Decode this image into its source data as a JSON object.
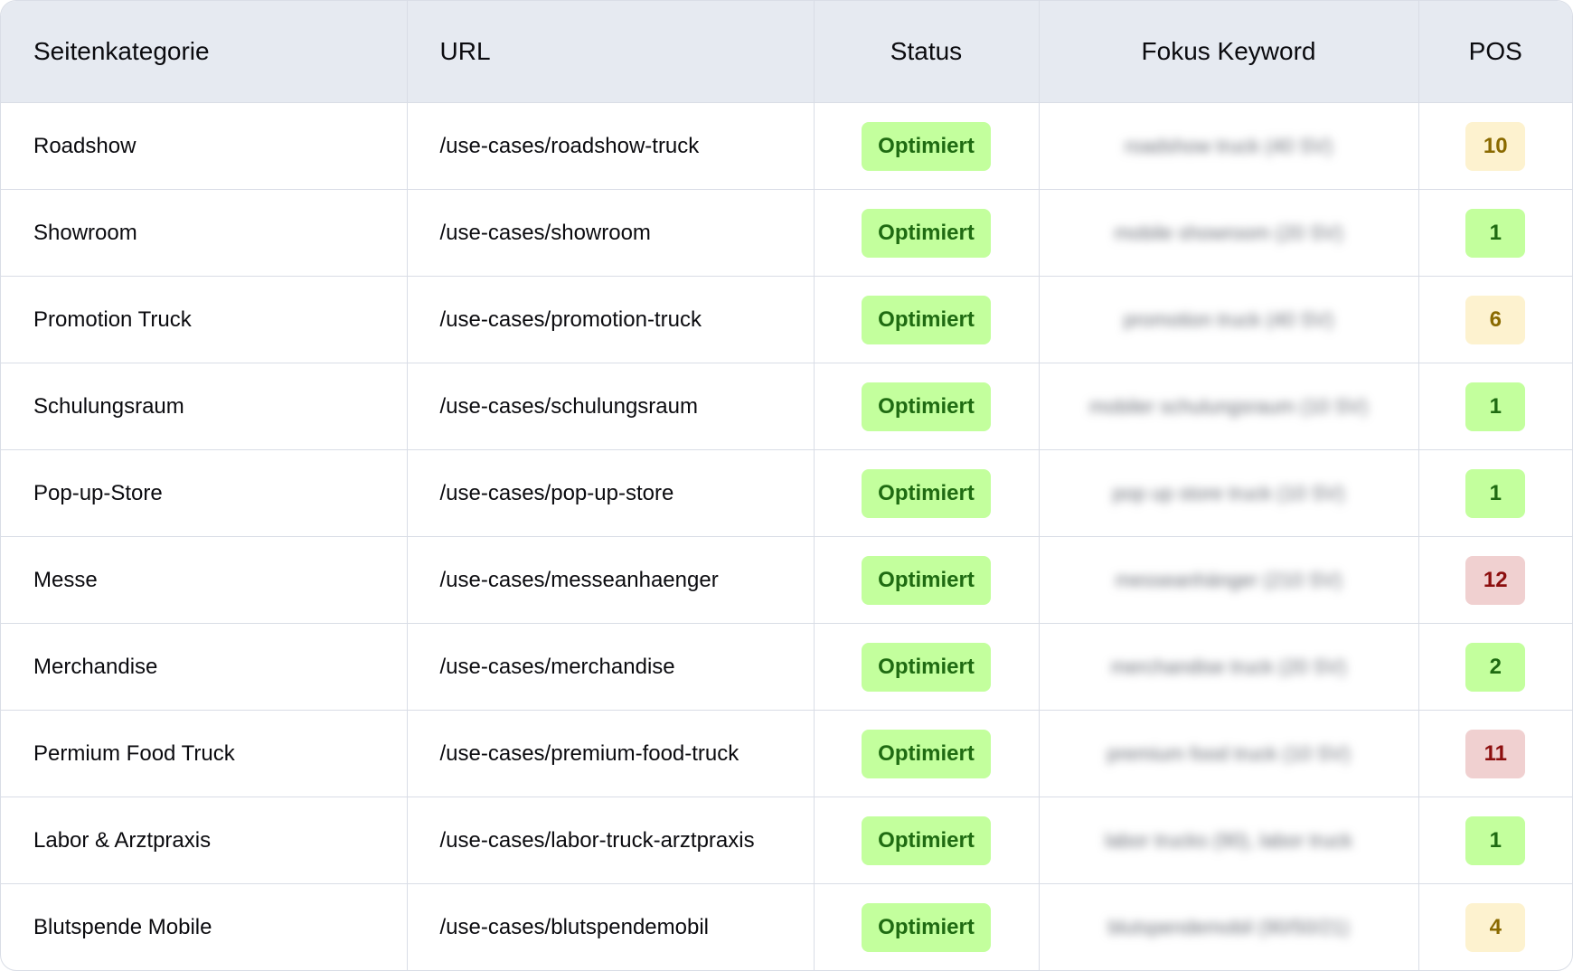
{
  "table": {
    "headers": {
      "category": "Seitenkategorie",
      "url": "URL",
      "status": "Status",
      "keyword": "Fokus Keyword",
      "pos": "POS"
    },
    "rows": [
      {
        "category": "Roadshow",
        "url": "/use-cases/roadshow-truck",
        "status": "Optimiert",
        "keyword": "roadshow truck (40 SV)",
        "pos": "10",
        "pos_level": "mid"
      },
      {
        "category": "Showroom",
        "url": "/use-cases/showroom",
        "status": "Optimiert",
        "keyword": "mobile showroom (20 SV)",
        "pos": "1",
        "pos_level": "good"
      },
      {
        "category": "Promotion Truck",
        "url": "/use-cases/promotion-truck",
        "status": "Optimiert",
        "keyword": "promotion truck (40 SV)",
        "pos": "6",
        "pos_level": "mid"
      },
      {
        "category": "Schulungsraum",
        "url": "/use-cases/schulungsraum",
        "status": "Optimiert",
        "keyword": "mobiler schulungsraum (10 SV)",
        "pos": "1",
        "pos_level": "good"
      },
      {
        "category": "Pop-up-Store",
        "url": "/use-cases/pop-up-store",
        "status": "Optimiert",
        "keyword": "pop up store truck (10 SV)",
        "pos": "1",
        "pos_level": "good"
      },
      {
        "category": "Messe",
        "url": "/use-cases/messeanhaenger",
        "status": "Optimiert",
        "keyword": "messeanhänger (210 SV)",
        "pos": "12",
        "pos_level": "bad"
      },
      {
        "category": "Merchandise",
        "url": "/use-cases/merchandise",
        "status": "Optimiert",
        "keyword": "merchandise truck (20 SV)",
        "pos": "2",
        "pos_level": "good"
      },
      {
        "category": "Permium Food Truck",
        "url": "/use-cases/premium-food-truck",
        "status": "Optimiert",
        "keyword": "premium food truck (10 SV)",
        "pos": "11",
        "pos_level": "bad"
      },
      {
        "category": "Labor & Arztpraxis",
        "url": "/use-cases/labor-truck-arztpraxis",
        "status": "Optimiert",
        "keyword": "labor trucks (90), labor truck",
        "pos": "1",
        "pos_level": "good"
      },
      {
        "category": "Blutspende Mobile",
        "url": "/use-cases/blutspendemobil",
        "status": "Optimiert",
        "keyword": "blutspendemobil (90/50/21)",
        "pos": "4",
        "pos_level": "mid"
      }
    ]
  },
  "colors": {
    "header_bg": "#e6eaf1",
    "border": "#d9dde6",
    "status_bg": "#c3ff9d",
    "status_text": "#1f6b12",
    "pos_good_bg": "#c3ff9d",
    "pos_mid_bg": "#fdf2cf",
    "pos_bad_bg": "#f0d0d0"
  }
}
